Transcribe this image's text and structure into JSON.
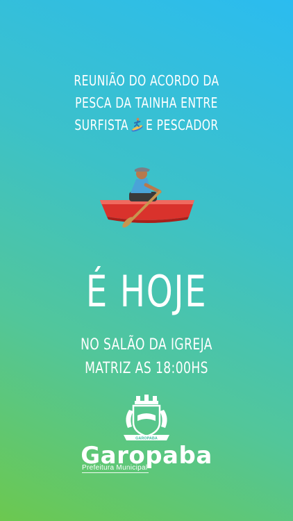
{
  "header": {
    "line1": "REUNIÃO DO ACORDO DA",
    "line2": "PESCA DA TAINHA ENTRE",
    "line3_before": "SURFISTA",
    "line3_after": "E PESCADOR"
  },
  "icons": {
    "surfer": "surfer-emoji",
    "rowboat": "person-rowing-boat-emoji",
    "crest": "garopaba-coat-of-arms"
  },
  "headline": "É HOJE",
  "location": {
    "line1": "NO SALÃO DA IGREJA",
    "line2": "MATRIZ AS 18:00HS"
  },
  "logo": {
    "name": "Garopaba",
    "subtitle": "Prefeitura Municipal",
    "crest_banner": "GAROPABA"
  },
  "colors": {
    "gradient_top": "#2bbcf0",
    "gradient_bottom": "#6cc84f",
    "text": "#ffffff",
    "boat_hull": "#d9322c"
  }
}
